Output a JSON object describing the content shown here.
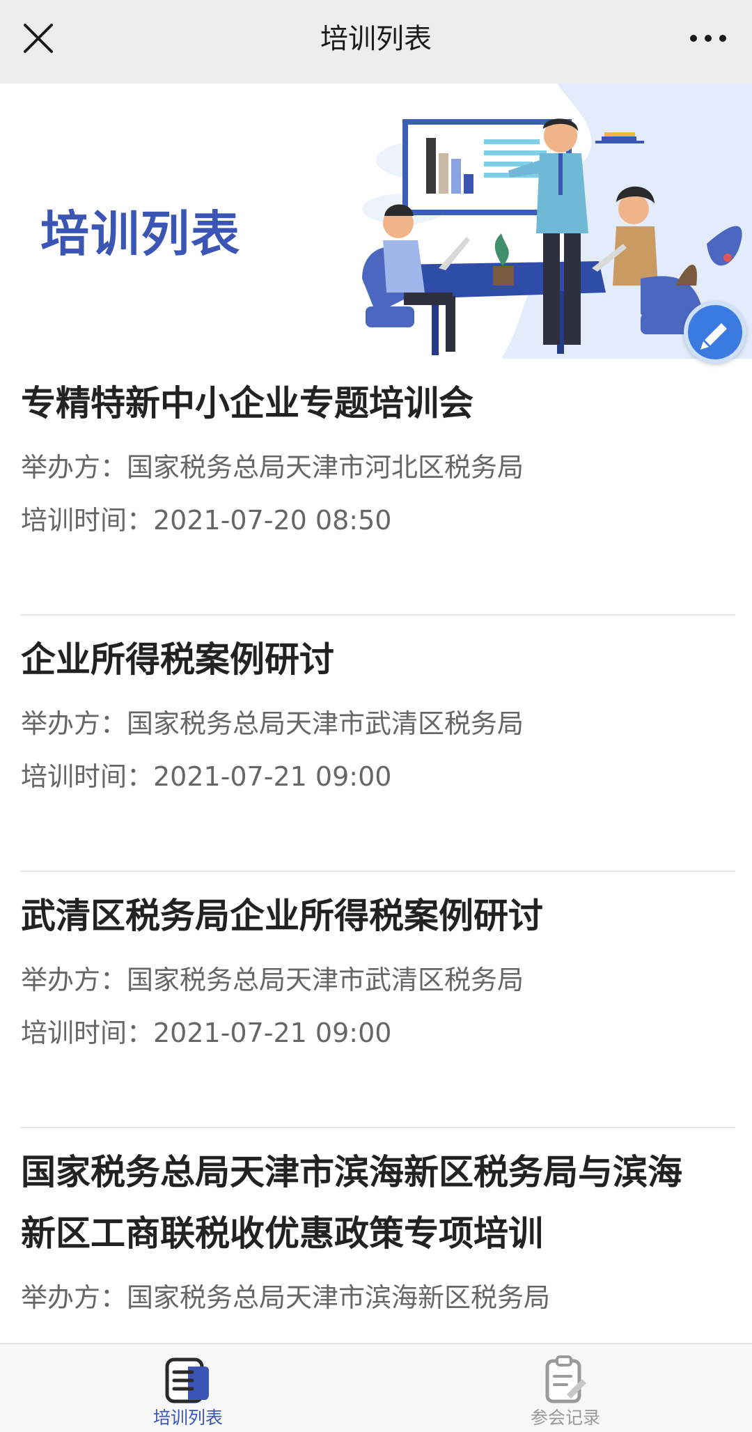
{
  "header": {
    "title": "培训列表",
    "close_icon": "close-icon",
    "more_icon": "more-horizontal-icon"
  },
  "banner": {
    "title": "培训列表",
    "illustration": "meeting-presentation-illustration",
    "float_icon": "edit-pen-icon"
  },
  "trainings": [
    {
      "title": "专精特新中小企业专题培训会",
      "organizer": "举办方：国家税务总局天津市河北区税务局",
      "time": "培训时间：2021-07-20 08:50"
    },
    {
      "title": "企业所得税案例研讨",
      "organizer": "举办方：国家税务总局天津市武清区税务局",
      "time": "培训时间：2021-07-21 09:00"
    },
    {
      "title": "武清区税务局企业所得税案例研讨",
      "organizer": "举办方：国家税务总局天津市武清区税务局",
      "time": "培训时间：2021-07-21 09:00"
    },
    {
      "title_line1": "国家税务总局天津市滨海新区税务局与滨海",
      "title_line2": "新区工商联税收优惠政策专项培训",
      "organizer": "举办方：国家税务总局天津市滨海新区税务局"
    }
  ],
  "tabs": [
    {
      "label": "培训列表",
      "icon": "training-list-icon",
      "active": true
    },
    {
      "label": "参会记录",
      "icon": "meeting-record-icon",
      "active": false
    }
  ],
  "colors": {
    "accent": "#3a55b4",
    "tab_active": "#3a55b4",
    "tab_inactive": "#9a9a9a",
    "topbar_bg": "#ededed"
  }
}
